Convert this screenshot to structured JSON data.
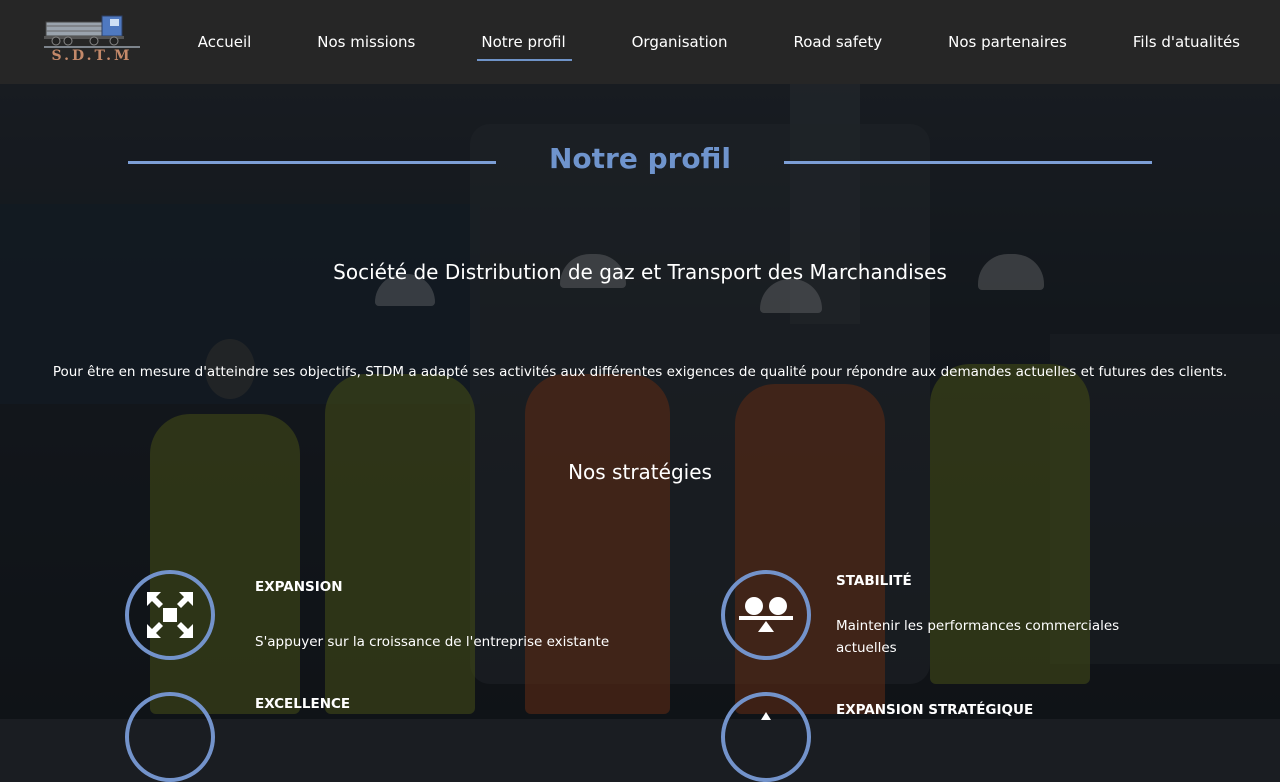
{
  "logo": {
    "text": "S.D.T.M",
    "icon": "truck-icon"
  },
  "nav": {
    "items": [
      {
        "label": "Accueil"
      },
      {
        "label": "Nos missions"
      },
      {
        "label": "Notre profil"
      },
      {
        "label": "Organisation"
      },
      {
        "label": "Road safety"
      },
      {
        "label": "Nos partenaires"
      },
      {
        "label": "Fils d'atualités"
      }
    ],
    "active": "Notre profil"
  },
  "page": {
    "title": "Notre profil",
    "subtitle": "Société de Distribution de gaz et Transport des Marchandises",
    "intro": "Pour être en mesure d'atteindre ses objectifs, STDM a adapté ses activités aux différentes exigences de qualité pour répondre aux demandes actuelles et futures des clients.",
    "strategies_title": "Nos stratégies"
  },
  "strategies": [
    {
      "title": "EXPANSION",
      "desc": "S'appuyer sur la croissance de l'entreprise existante",
      "icon": "expand-arrows-icon"
    },
    {
      "title": "STABILITÉ",
      "desc": "Maintenir les performances commerciales actuelles",
      "icon": "balance-icon"
    },
    {
      "title": "EXCELLENCE",
      "desc": "",
      "icon": "excellence-icon"
    },
    {
      "title": "EXPANSION STRATÉGIQUE",
      "desc": "",
      "icon": "strategic-expansion-icon"
    }
  ],
  "colors": {
    "accent": "#6f94cd",
    "header_bg": "#262626",
    "logo_text": "#c4896a"
  }
}
